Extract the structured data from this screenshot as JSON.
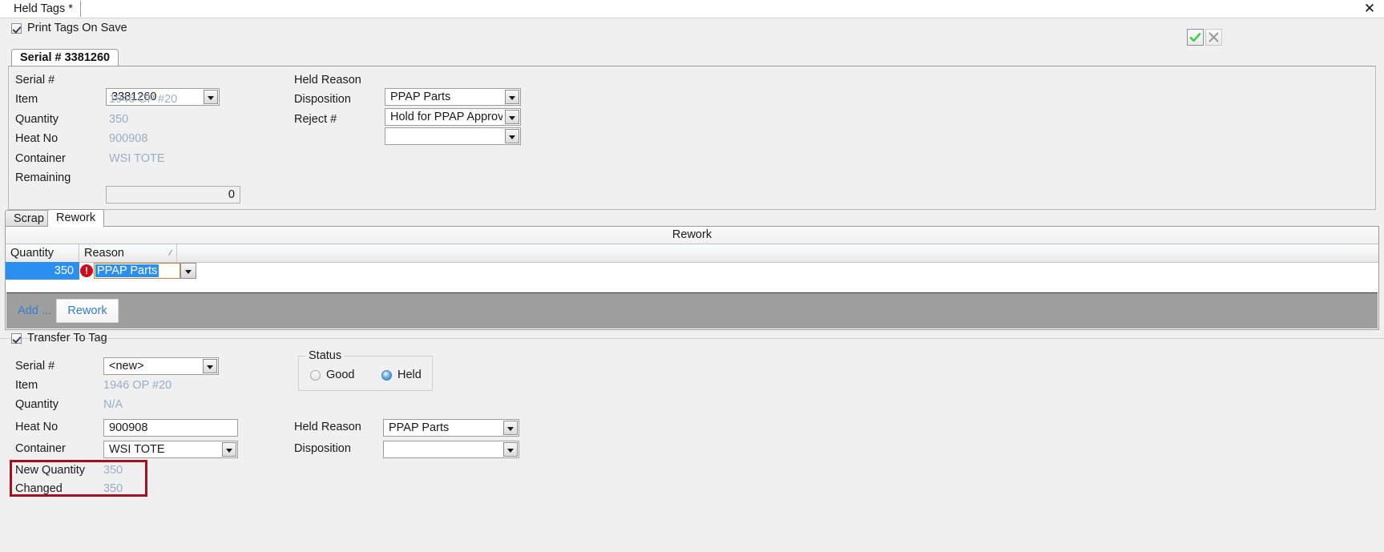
{
  "window": {
    "tab_label": "Held Tags *",
    "close_icon": "close-icon"
  },
  "toolbar": {
    "print_tags_label": "Print Tags On Save",
    "print_tags_checked": true,
    "accept_icon": "checkmark-icon",
    "cancel_icon": "cross-icon",
    "accept_color": "#3ad14a",
    "cancel_color": "#9a9a9a"
  },
  "serial_tab": {
    "label": "Serial # 3381260"
  },
  "source": {
    "serial_label": "Serial #",
    "serial_value": "3381260",
    "item_label": "Item",
    "item_value": "1946 OP #20",
    "quantity_label": "Quantity",
    "quantity_value": "350",
    "heat_no_label": "Heat No",
    "heat_no_value": "900908",
    "container_label": "Container",
    "container_value": "WSI TOTE",
    "remaining_label": "Remaining",
    "remaining_value": "0",
    "held_reason_label": "Held Reason",
    "held_reason_value": "PPAP Parts",
    "disposition_label": "Disposition",
    "disposition_value": "Hold for PPAP Approval",
    "reject_label": "Reject #",
    "reject_value": ""
  },
  "inner_tabs": [
    {
      "label": "Scrap",
      "active": false
    },
    {
      "label": "Rework",
      "active": true
    }
  ],
  "grid": {
    "caption": "Rework",
    "columns": [
      "Quantity",
      "Reason"
    ],
    "sort_indicator": "⁄",
    "rows": [
      {
        "quantity": "350",
        "reason": "PPAP Parts",
        "error_icon": "error-exclamation-icon",
        "error_glyph": "!",
        "selected": true
      }
    ],
    "add_label": "Add ...",
    "action_button_label": "Rework",
    "selection_color": "#2a8ff0",
    "error_color": "#cc0f1f"
  },
  "transfer": {
    "checkbox_label": "Transfer To Tag",
    "checkbox_checked": true,
    "serial_label": "Serial #",
    "serial_value": "<new>",
    "item_label": "Item",
    "item_value": "1946 OP #20",
    "quantity_label": "Quantity",
    "quantity_value": "N/A",
    "heat_no_label": "Heat No",
    "heat_no_value": "900908",
    "container_label": "Container",
    "container_value": "WSI TOTE",
    "new_quantity_label": "New Quantity",
    "new_quantity_value": "350",
    "changed_label": "Changed",
    "changed_value": "350",
    "status": {
      "title": "Status",
      "options": [
        {
          "label": "Good",
          "selected": false
        },
        {
          "label": "Held",
          "selected": true
        }
      ]
    },
    "held_reason_label": "Held Reason",
    "held_reason_value": "PPAP Parts",
    "disposition_label": "Disposition",
    "disposition_value": ""
  },
  "highlight": {
    "color": "#a41220"
  }
}
